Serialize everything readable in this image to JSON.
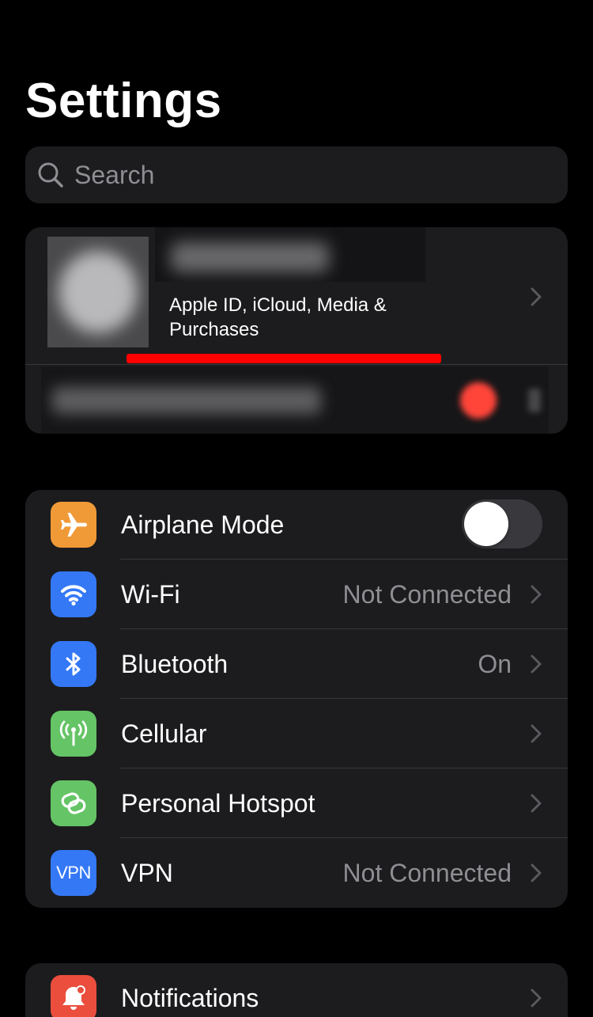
{
  "page": {
    "title": "Settings"
  },
  "search": {
    "placeholder": "Search"
  },
  "profile": {
    "subtitle": "Apple ID, iCloud, Media & Purchases"
  },
  "network_group": {
    "rows": [
      {
        "label": "Airplane Mode",
        "icon": "airplane-icon",
        "icon_color": "#f09a37",
        "toggle_on": false
      },
      {
        "label": "Wi-Fi",
        "value": "Not Connected",
        "icon": "wifi-icon",
        "icon_color": "#3478f6"
      },
      {
        "label": "Bluetooth",
        "value": "On",
        "icon": "bluetooth-icon",
        "icon_color": "#3478f6"
      },
      {
        "label": "Cellular",
        "icon": "cellular-icon",
        "icon_color": "#65c466"
      },
      {
        "label": "Personal Hotspot",
        "icon": "hotspot-icon",
        "icon_color": "#65c466"
      },
      {
        "label": "VPN",
        "value": "Not Connected",
        "icon": "vpn-icon",
        "icon_text": "VPN",
        "icon_color": "#3478f6"
      }
    ]
  },
  "notifications_group": {
    "rows": [
      {
        "label": "Notifications",
        "icon": "notifications-icon",
        "icon_color": "#eb4e3d"
      }
    ]
  },
  "colors": {
    "background": "#000000",
    "card": "#1c1c1e",
    "separator": "#38383a",
    "secondary_text": "#8e8e93",
    "annotation": "#ff0000"
  }
}
